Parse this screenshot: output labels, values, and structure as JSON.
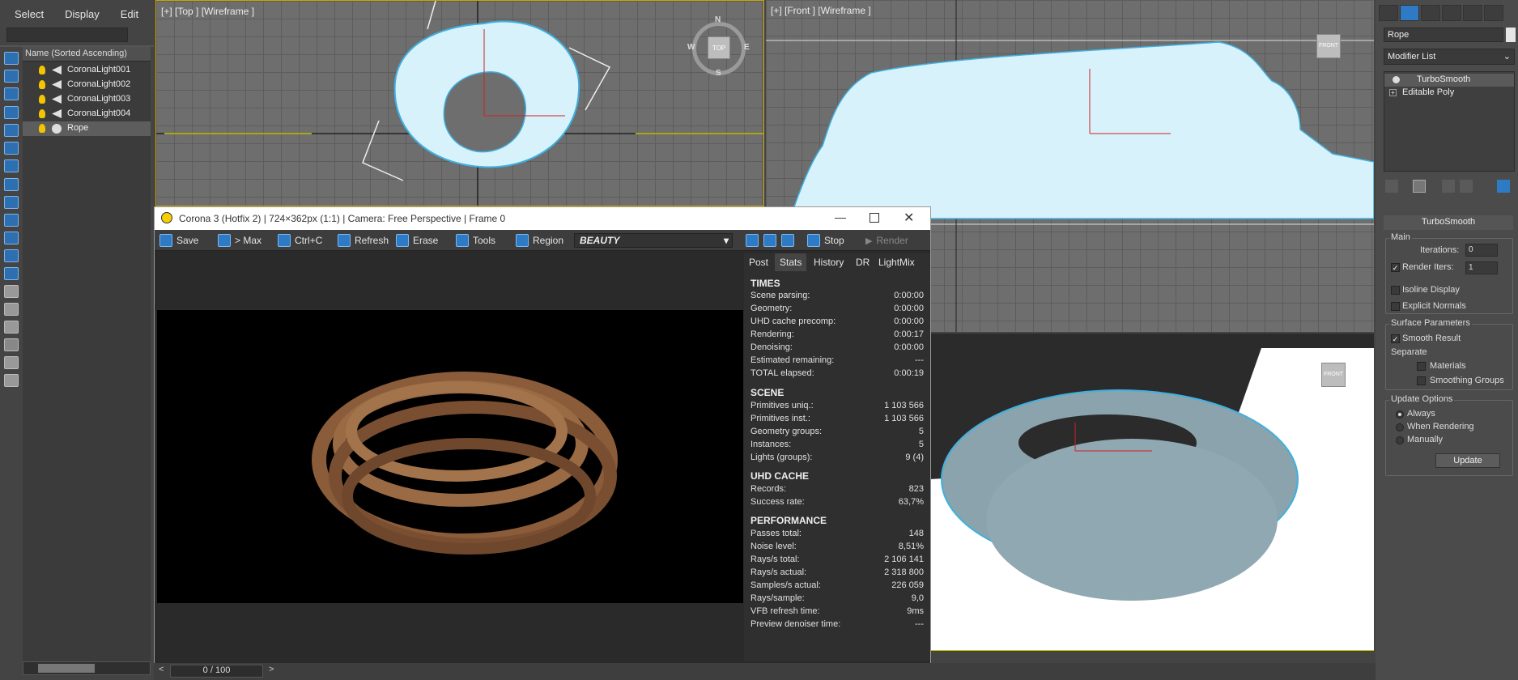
{
  "menu": [
    "Select",
    "Display",
    "Edit"
  ],
  "explorer": {
    "header": "Name (Sorted Ascending)",
    "items": [
      {
        "name": "CoronaLight001",
        "type": "light"
      },
      {
        "name": "CoronaLight002",
        "type": "light"
      },
      {
        "name": "CoronaLight003",
        "type": "light"
      },
      {
        "name": "CoronaLight004",
        "type": "light"
      },
      {
        "name": "Rope",
        "type": "geometry",
        "selected": true
      }
    ]
  },
  "viewports": {
    "top": {
      "label": "[+] [Top ] [Wireframe ]",
      "gizmo": [
        "N",
        "W",
        "TOP",
        "E",
        "S"
      ]
    },
    "front": {
      "label": "[+] [Front ] [Wireframe ]",
      "gizmo": "FRONT"
    },
    "perspective": {
      "gizmo": "FRONT"
    }
  },
  "vfb": {
    "title": "Corona 3 (Hotfix 2) | 724×362px (1:1) | Camera: Free Perspective | Frame 0",
    "toolbar": {
      "save": "Save",
      "max": "> Max",
      "copy": "Ctrl+C",
      "refresh": "Refresh",
      "erase": "Erase",
      "tools": "Tools",
      "region": "Region",
      "pass": "BEAUTY",
      "stop": "Stop",
      "render": "Render"
    },
    "tabs": [
      "Post",
      "Stats",
      "History",
      "DR",
      "LightMix"
    ],
    "active_tab": "Stats",
    "stats": {
      "times": {
        "title": "TIMES",
        "rows": [
          {
            "k": "Scene parsing:",
            "v": "0:00:00"
          },
          {
            "k": "Geometry:",
            "v": "0:00:00"
          },
          {
            "k": "UHD cache precomp:",
            "v": "0:00:00"
          },
          {
            "k": "Rendering:",
            "v": "0:00:17"
          },
          {
            "k": "Denoising:",
            "v": "0:00:00"
          },
          {
            "k": "Estimated remaining:",
            "v": "---"
          },
          {
            "k": "TOTAL elapsed:",
            "v": "0:00:19"
          }
        ]
      },
      "scene": {
        "title": "SCENE",
        "rows": [
          {
            "k": "Primitives uniq.:",
            "v": "1 103 566"
          },
          {
            "k": "Primitives inst.:",
            "v": "1 103 566"
          },
          {
            "k": "Geometry groups:",
            "v": "5"
          },
          {
            "k": "Instances:",
            "v": "5"
          },
          {
            "k": "Lights (groups):",
            "v": "9 (4)"
          }
        ]
      },
      "uhd": {
        "title": "UHD CACHE",
        "rows": [
          {
            "k": "Records:",
            "v": "823"
          },
          {
            "k": "Success rate:",
            "v": "63,7%"
          }
        ]
      },
      "performance": {
        "title": "PERFORMANCE",
        "rows": [
          {
            "k": "Passes total:",
            "v": "148"
          },
          {
            "k": "Noise level:",
            "v": "8,51%"
          },
          {
            "k": "Rays/s total:",
            "v": "2 106 141"
          },
          {
            "k": "Rays/s actual:",
            "v": "2 318 800"
          },
          {
            "k": "Samples/s actual:",
            "v": "226 059"
          },
          {
            "k": "Rays/sample:",
            "v": "9,0"
          },
          {
            "k": "VFB refresh time:",
            "v": "9ms"
          },
          {
            "k": "Preview denoiser time:",
            "v": "---"
          }
        ]
      }
    }
  },
  "timeline": {
    "counter": "0 / 100"
  },
  "command_panel": {
    "object_name": "Rope",
    "modifier_list": "Modifier List",
    "stack": [
      "TurboSmooth",
      "Editable Poly"
    ],
    "rollout": "TurboSmooth",
    "main": {
      "label": "Main",
      "iterations_label": "Iterations:",
      "iterations": "0",
      "render_iters_label": "Render Iters:",
      "render_iters": "1",
      "render_iters_checked": true,
      "isoline": "Isoline Display",
      "explicit": "Explicit Normals"
    },
    "surface": {
      "label": "Surface Parameters",
      "smooth_result": "Smooth Result",
      "smooth_checked": true,
      "separate": "Separate",
      "materials": "Materials",
      "smoothing_groups": "Smoothing Groups"
    },
    "update": {
      "label": "Update Options",
      "always": "Always",
      "when_rendering": "When Rendering",
      "manually": "Manually",
      "button": "Update"
    }
  },
  "colors": {
    "accent": "#2e7ac4",
    "rope_render": "#8a5c3a",
    "wire_fill": "#d8f2fb",
    "viewport_bg": "#6e6e6e"
  }
}
